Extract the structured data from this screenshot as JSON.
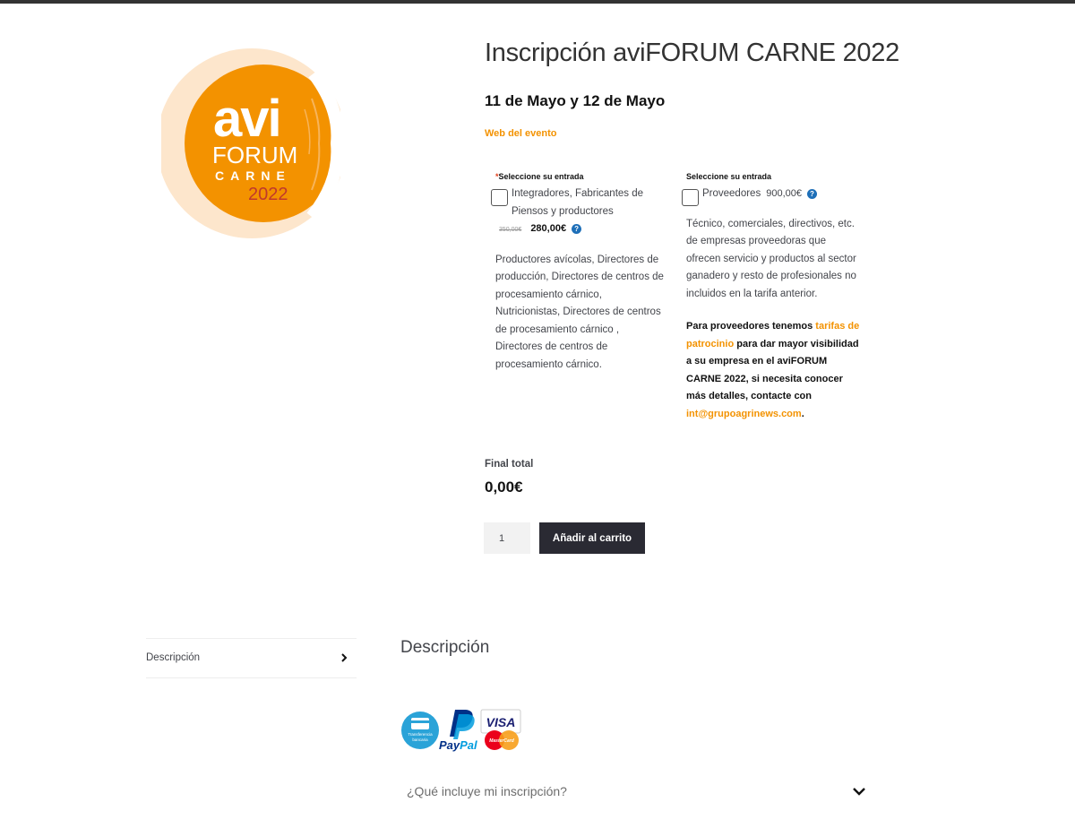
{
  "logo": {
    "line1": "avi",
    "line2": "FORUM",
    "line3": "CARNE",
    "line4": "2022",
    "brand_color": "#f39200",
    "accent_red": "#c0392b"
  },
  "product": {
    "title": "Inscripción aviFORUM CARNE 2022",
    "dates": "11 de Mayo y 12 de Mayo",
    "event_link": "Web del evento"
  },
  "options": {
    "col1": {
      "required_mark": "*",
      "label": "Seleccione su entrada",
      "option_text": "Integradores, Fabricantes de Piensos y productores",
      "old_price": "350,00€",
      "price": "280,00€",
      "help_icon": "question-circle-icon",
      "description": "Productores avícolas, Directores de producción, Directores de centros de procesamiento cárnico, Nutricionistas, Directores de centros de procesamiento cárnico , Directores de centros de procesamiento cárnico."
    },
    "col2": {
      "label": "Seleccione su entrada",
      "option_text": "Proveedores",
      "price": "900,00€",
      "help_icon": "question-circle-icon",
      "description": "Técnico, comerciales, directivos, etc. de empresas proveedoras que ofrecen servicio y productos al sector ganadero y resto de profesionales no incluidos en la tarifa anterior.",
      "note_part1": "Para proveedores tenemos ",
      "note_link": "tarifas de patrocinio",
      "note_part2": " para dar mayor visibilidad a su empresa en el aviFORUM CARNE 2022, si necesita conocer más detalles, contacte con ",
      "note_email": "int@grupoagrinews.com",
      "note_end": "."
    }
  },
  "totals": {
    "label": "Final total",
    "value": "0,00€"
  },
  "cart": {
    "quantity": "1",
    "add_label": "Añadir al carrito",
    "button_color": "#2a2a33"
  },
  "tabs": {
    "items": [
      {
        "label": "Descripción",
        "icon": "chevron-right-icon"
      }
    ],
    "section_title": "Descripción"
  },
  "payments": {
    "transfer_line1": "Transferencia",
    "transfer_line2": "bancaria",
    "paypal_a": "Pay",
    "paypal_b": "Pal",
    "visa": "VISA",
    "mastercard": "MasterCard"
  },
  "faq": {
    "question": "¿Qué incluye mi inscripción?",
    "icon": "chevron-down-icon"
  }
}
